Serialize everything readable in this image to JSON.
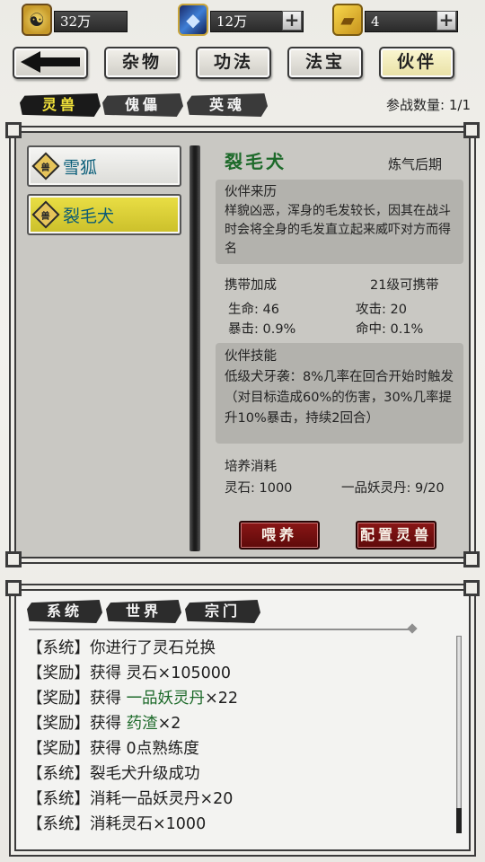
{
  "resources": {
    "spirit_coin": {
      "icon": "bagua-coin-icon",
      "value": "32万"
    },
    "crystal": {
      "icon": "blue-crystal-icon",
      "value": "12万"
    },
    "gold": {
      "icon": "gold-ingot-icon",
      "value": "4"
    }
  },
  "nav": {
    "back": "back-arrow-icon",
    "tabs": [
      "杂物",
      "功法",
      "法宝",
      "伙伴"
    ],
    "active": "伙伴"
  },
  "sub_tabs": {
    "items": [
      "灵兽",
      "傀儡",
      "英魂"
    ],
    "active": "灵兽",
    "battle_count_label": "参战数量: 1/1"
  },
  "pets": [
    {
      "name": "雪狐",
      "icon": "beast-badge-icon",
      "badge": "兽"
    },
    {
      "name": "裂毛犬",
      "icon": "beast-badge-icon",
      "badge": "兽"
    }
  ],
  "detail": {
    "name": "裂毛犬",
    "realm": "炼气后期",
    "origin_title": "伙伴来历",
    "origin_text": "样貌凶恶，浑身的毛发较长，因其在战斗时会将全身的毛发直立起来威吓对方而得名",
    "bonus_title": "携带加成",
    "bonus_req": "21级可携带",
    "stats": {
      "hp": "生命: 46",
      "atk": "攻击: 20",
      "crit": "暴击: 0.9%",
      "hit": "命中: 0.1%"
    },
    "skill_title": "伙伴技能",
    "skill_text": "低级犬牙袭：8%几率在回合开始时触发（对目标造成60%的伤害，30%几率提升10%暴击，持续2回合）",
    "cost_title": "培养消耗",
    "cost_stone": "灵石: 1000",
    "cost_pill": "一品妖灵丹: 9/20",
    "btn_feed": "喂养",
    "btn_config": "配置灵兽"
  },
  "log": {
    "tabs": [
      "系统",
      "世界",
      "宗门"
    ],
    "lines": [
      {
        "prefix": "【系统】你进行了灵石兑换",
        "hl": "",
        "suffix": ""
      },
      {
        "prefix": "【奖励】获得 灵石×105000",
        "hl": "",
        "suffix": ""
      },
      {
        "prefix": "【奖励】获得 ",
        "hl": "一品妖灵丹",
        "suffix": "×22"
      },
      {
        "prefix": "【奖励】获得 ",
        "hl": "药渣",
        "suffix": "×2"
      },
      {
        "prefix": "【奖励】获得 0点熟练度",
        "hl": "",
        "suffix": ""
      },
      {
        "prefix": "【系统】裂毛犬升级成功",
        "hl": "",
        "suffix": ""
      },
      {
        "prefix": "【系统】消耗一品妖灵丹×20",
        "hl": "",
        "suffix": ""
      },
      {
        "prefix": "【系统】消耗灵石×1000",
        "hl": "",
        "suffix": ""
      }
    ]
  },
  "colors": {
    "active_tab_text": "#f2e23a",
    "pet_name_green": "#1d6a2a",
    "button_red": "#7a1111",
    "selected_item": "#d8cc36"
  }
}
